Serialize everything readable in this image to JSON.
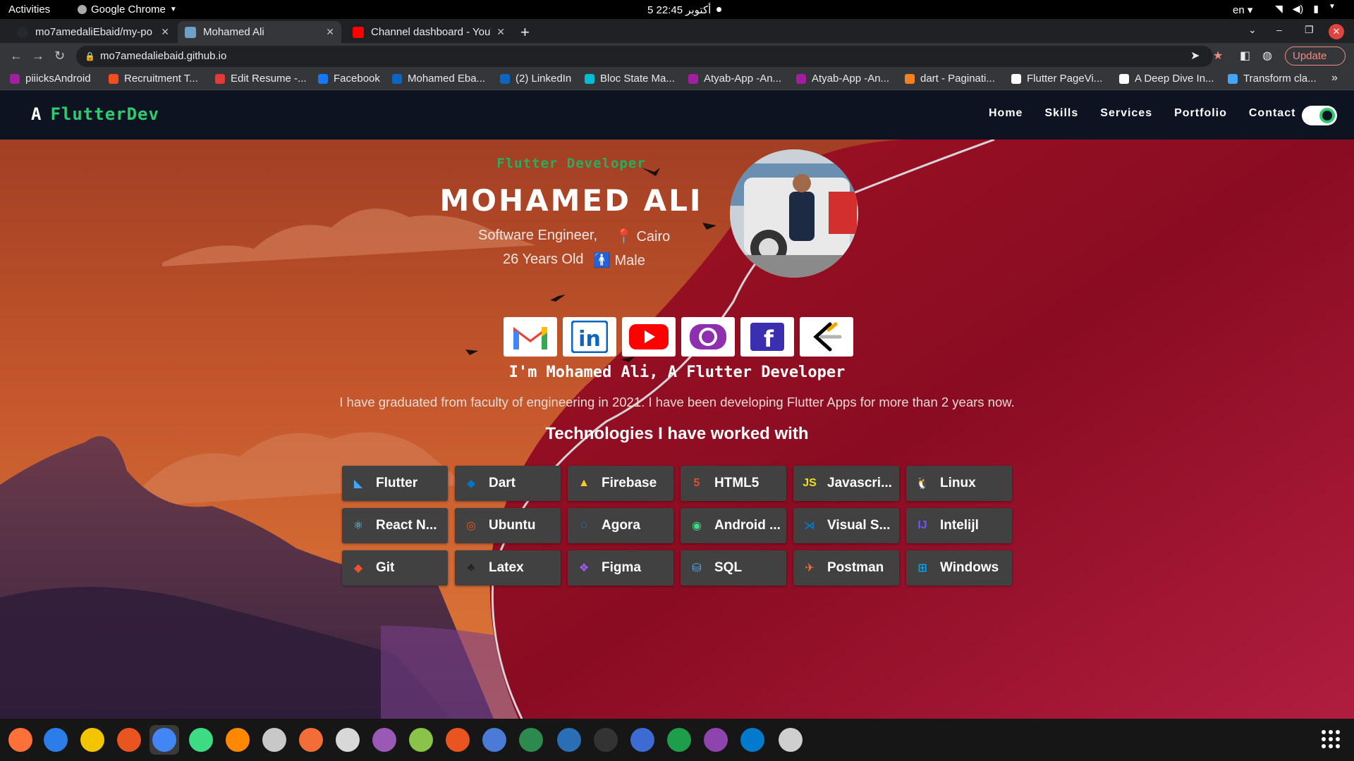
{
  "system_bar": {
    "activities": "Activities",
    "app_name": "Google Chrome",
    "clock": "5 أكتوبر  22:45",
    "language": "en"
  },
  "browser": {
    "tabs": [
      {
        "title": "mo7amedaliEbaid/my-po",
        "favicon_color": "#24292f",
        "active": false
      },
      {
        "title": "Mohamed Ali",
        "favicon_color": "#6ea0c8",
        "active": true
      },
      {
        "title": "Channel dashboard - YouT",
        "favicon_color": "#ff0000",
        "active": false
      }
    ],
    "url": "mo7amedaliebaid.github.io",
    "update_label": "Update",
    "bookmarks": [
      {
        "label": "piiicksAndroid",
        "color": "#a020a0"
      },
      {
        "label": "Recruitment T...",
        "color": "#f24e1e"
      },
      {
        "label": "Edit Resume -...",
        "color": "#e53935"
      },
      {
        "label": "Facebook",
        "color": "#1877f2"
      },
      {
        "label": "Mohamed Eba...",
        "color": "#0a66c2"
      },
      {
        "label": "(2) LinkedIn",
        "color": "#0a66c2"
      },
      {
        "label": "Bloc State Ma...",
        "color": "#00bcd4"
      },
      {
        "label": "Atyab-App -An...",
        "color": "#a020a0"
      },
      {
        "label": "Atyab-App -An...",
        "color": "#a020a0"
      },
      {
        "label": "dart - Paginati...",
        "color": "#f48024"
      },
      {
        "label": "Flutter PageVi...",
        "color": "#ffffff"
      },
      {
        "label": "A Deep Dive In...",
        "color": "#ffffff"
      },
      {
        "label": "Transform cla...",
        "color": "#42a5f5"
      }
    ]
  },
  "site": {
    "logo_text": "FlutterDev",
    "nav": [
      "Home",
      "Skills",
      "Services",
      "Portfolio",
      "Contact"
    ],
    "hero": {
      "role": "Flutter Developer",
      "name": "MOHAMED ALI",
      "title": "Software Engineer,",
      "location": "Cairo",
      "age": "26 Years Old",
      "gender": "Male"
    },
    "socials": [
      "gmail-icon",
      "linkedin-icon",
      "youtube-icon",
      "github-icon",
      "facebook-icon",
      "leetcode-icon"
    ],
    "intro": "I'm Mohamed Ali, A Flutter Developer",
    "about": "I have graduated from faculty of engineering in 2021. I have been developing Flutter Apps for more than 2 years now.",
    "tech_title": "Technologies I have worked with",
    "technologies": [
      {
        "label": "Flutter",
        "icon": "flutter-icon",
        "color": "#42a5f5",
        "glyph": "◣"
      },
      {
        "label": "Dart",
        "icon": "dart-icon",
        "color": "#0175c2",
        "glyph": "◆"
      },
      {
        "label": "Firebase",
        "icon": "firebase-icon",
        "color": "#ffca28",
        "glyph": "▲"
      },
      {
        "label": "HTML5",
        "icon": "html5-icon",
        "color": "#e34f26",
        "glyph": "5"
      },
      {
        "label": "Javascri...",
        "icon": "javascript-icon",
        "color": "#f7df1e",
        "glyph": "JS"
      },
      {
        "label": "Linux",
        "icon": "linux-icon",
        "color": "#ffffff",
        "glyph": "🐧"
      },
      {
        "label": "React N...",
        "icon": "react-icon",
        "color": "#61dafb",
        "glyph": "⚛"
      },
      {
        "label": "Ubuntu",
        "icon": "ubuntu-icon",
        "color": "#e95420",
        "glyph": "◎"
      },
      {
        "label": "Agora",
        "icon": "agora-icon",
        "color": "#099dfd",
        "glyph": "◌"
      },
      {
        "label": "Android ...",
        "icon": "android-studio-icon",
        "color": "#3ddc84",
        "glyph": "◉"
      },
      {
        "label": "Visual S...",
        "icon": "vscode-icon",
        "color": "#007acc",
        "glyph": "⋊"
      },
      {
        "label": "Intelijl",
        "icon": "intellij-icon",
        "color": "#6b57ff",
        "glyph": "IJ"
      },
      {
        "label": "Git",
        "icon": "git-icon",
        "color": "#f05032",
        "glyph": "◆"
      },
      {
        "label": "Latex",
        "icon": "latex-icon",
        "color": "#222222",
        "glyph": "♣"
      },
      {
        "label": "Figma",
        "icon": "figma-icon",
        "color": "#a259ff",
        "glyph": "❖"
      },
      {
        "label": "SQL",
        "icon": "sql-icon",
        "color": "#4fb3ff",
        "glyph": "⛁"
      },
      {
        "label": "Postman",
        "icon": "postman-icon",
        "color": "#ff6c37",
        "glyph": "✈"
      },
      {
        "label": "Windows",
        "icon": "windows-icon",
        "color": "#00a4ef",
        "glyph": "⊞"
      }
    ]
  },
  "dock": [
    {
      "icon": "firefox-icon",
      "color": "#ff7139"
    },
    {
      "icon": "thunderbird-icon",
      "color": "#2b7de9"
    },
    {
      "icon": "rhythmbox-icon",
      "color": "#f2c500"
    },
    {
      "icon": "software-center-icon",
      "color": "#e95420"
    },
    {
      "icon": "chrome-icon",
      "color": "#4285f4"
    },
    {
      "icon": "android-studio-icon",
      "color": "#3ddc84"
    },
    {
      "icon": "vlc-icon",
      "color": "#ff8800"
    },
    {
      "icon": "files-icon",
      "color": "#c8c8c8"
    },
    {
      "icon": "inkscape-icon",
      "color": "#f36e36"
    },
    {
      "icon": "text-editor-icon",
      "color": "#d8d8d8"
    },
    {
      "icon": "video-player-icon",
      "color": "#9b59b6"
    },
    {
      "icon": "android-emulator-icon",
      "color": "#8bc34a"
    },
    {
      "icon": "ubuntu-icon",
      "color": "#e95420"
    },
    {
      "icon": "tasks-icon",
      "color": "#4a7bd6"
    },
    {
      "icon": "camera-icon",
      "color": "#2d8a4e"
    },
    {
      "icon": "libreoffice-writer-icon",
      "color": "#2a6fb6"
    },
    {
      "icon": "terminal-icon",
      "color": "#333333"
    },
    {
      "icon": "screenshot-icon",
      "color": "#3c6bd4"
    },
    {
      "icon": "libreoffice-calc-icon",
      "color": "#1e9e4a"
    },
    {
      "icon": "intellij-icon",
      "color": "#8e44ad"
    },
    {
      "icon": "vscode-icon",
      "color": "#007acc"
    },
    {
      "icon": "app-updater-icon",
      "color": "#cfcfcf"
    }
  ]
}
